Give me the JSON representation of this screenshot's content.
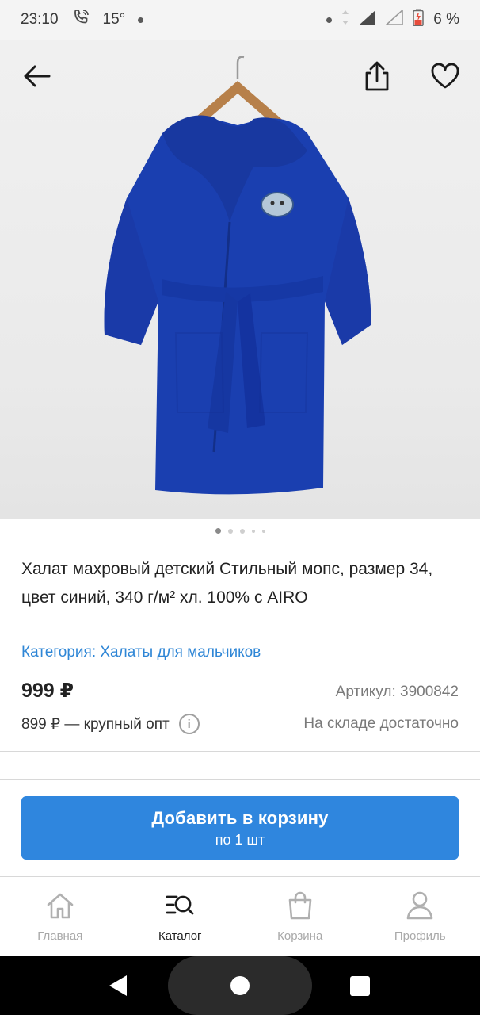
{
  "status_bar": {
    "time": "23:10",
    "temperature": "15°",
    "battery": "6 %"
  },
  "product": {
    "title": "Халат махровый детский Стильный мопс, размер 34, цвет синий, 340 г/м² хл. 100% с AIRO",
    "category_link": "Категория: Халаты для мальчиков",
    "price": "999 ₽",
    "article": "Артикул: 3900842",
    "wholesale_price": "899 ₽ — крупный опт",
    "stock": "На складе достаточно",
    "image_count": 5,
    "active_image": 1,
    "robe_color": "#1a3fb0"
  },
  "actions": {
    "back_icon": "arrow-left-icon",
    "share_icon": "share-icon",
    "favorite_icon": "heart-icon"
  },
  "cart_button": {
    "label": "Добавить в корзину",
    "sublabel": "по 1 шт",
    "color": "#2f86de"
  },
  "tabbar": {
    "items": [
      {
        "label": "Главная",
        "icon": "home-icon",
        "active": false
      },
      {
        "label": "Каталог",
        "icon": "catalog-search-icon",
        "active": true
      },
      {
        "label": "Корзина",
        "icon": "bag-icon",
        "active": false
      },
      {
        "label": "Профиль",
        "icon": "profile-icon",
        "active": false
      }
    ]
  },
  "colors": {
    "accent": "#2f86de",
    "link": "#2e86d6",
    "muted": "#7a7a7a"
  }
}
